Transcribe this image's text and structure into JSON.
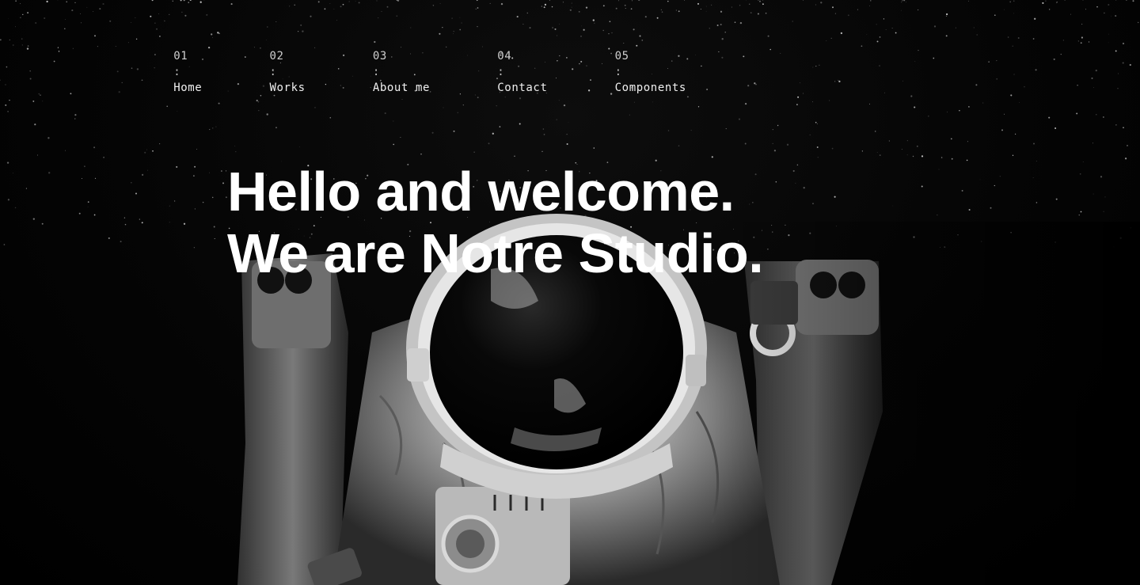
{
  "nav": {
    "items": [
      {
        "number": "01",
        "separator": ":",
        "label": "Home"
      },
      {
        "number": "02",
        "separator": ":",
        "label": "Works"
      },
      {
        "number": "03",
        "separator": ":",
        "label": "About me"
      },
      {
        "number": "04",
        "separator": ":",
        "label": "Contact"
      },
      {
        "number": "05",
        "separator": ":",
        "label": "Components"
      }
    ]
  },
  "hero": {
    "headline_line1": "Hello and welcome.",
    "headline_line2": "We are Notre Studio."
  },
  "colors": {
    "background": "#000000",
    "text": "#ffffff"
  }
}
